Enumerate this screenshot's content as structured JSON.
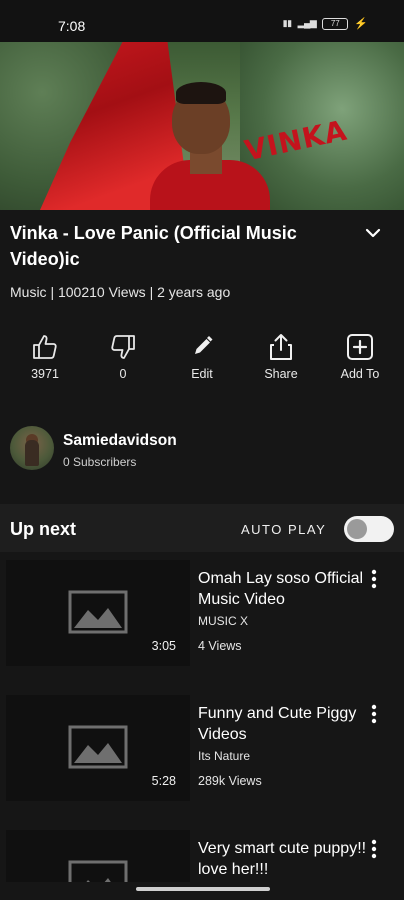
{
  "status_bar": {
    "time": "7:08",
    "network_text": "ᵀᵂᴼ ᴸᵀᴱ",
    "battery_text": "77"
  },
  "video": {
    "title": "Vinka - Love Panic (Official Music Video)ic",
    "meta": "Music | 100210 Views | 2 years ago",
    "hero_logo_text": "VINKA"
  },
  "actions": [
    {
      "icon": "thumb-up-icon",
      "label": "3971"
    },
    {
      "icon": "thumb-down-icon",
      "label": "0"
    },
    {
      "icon": "pencil-icon",
      "label": "Edit"
    },
    {
      "icon": "share-icon",
      "label": "Share"
    },
    {
      "icon": "add-box-icon",
      "label": "Add To"
    }
  ],
  "channel": {
    "name": "Samiedavidson",
    "subscribers": "0 Subscribers"
  },
  "up_next": {
    "label": "Up next",
    "autoplay_label": "AUTO PLAY",
    "autoplay_on": false
  },
  "items": [
    {
      "title": "Omah Lay   soso Official Music Video",
      "channel": "MUSIC X",
      "views": "4 Views",
      "duration": "3:05"
    },
    {
      "title": "Funny and Cute Piggy Videos",
      "channel": "Its Nature",
      "views": "289k Views",
      "duration": "5:28"
    },
    {
      "title": "Very smart cute puppy!! love her!!!",
      "channel": "",
      "views": "",
      "duration": ""
    }
  ],
  "colors": {
    "background": "#161616",
    "accent_red": "#c4131d"
  }
}
